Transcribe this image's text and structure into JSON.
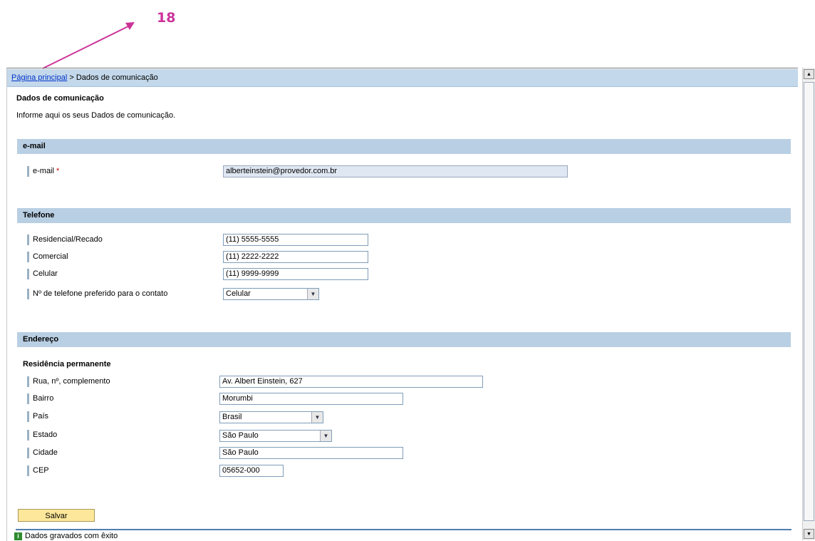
{
  "annotation": {
    "number": "18",
    "color": "#cc3399"
  },
  "breadcrumb": {
    "home_link": "Página principal",
    "separator": ">",
    "current": "Dados de comunicação"
  },
  "page": {
    "title": "Dados de comunicação",
    "description": "Informe aqui os seus Dados de comunicação."
  },
  "email_section": {
    "title": "e-mail",
    "label": "e-mail",
    "required_mark": "*",
    "value": "alberteinstein@provedor.com.br"
  },
  "phone_section": {
    "title": "Telefone",
    "residential": {
      "label": "Residencial/Recado",
      "value": "(11) 5555-5555"
    },
    "commercial": {
      "label": "Comercial",
      "value": "(11) 2222-2222"
    },
    "mobile": {
      "label": "Celular",
      "value": "(11) 9999-9999"
    },
    "preferred": {
      "label": "Nº de telefone preferido para o contato",
      "value": "Celular"
    }
  },
  "address_section": {
    "title": "Endereço",
    "subtitle": "Residência permanente",
    "street": {
      "label": "Rua, nº, complemento",
      "value": "Av. Albert Einstein, 627"
    },
    "district": {
      "label": "Bairro",
      "value": "Morumbi"
    },
    "country": {
      "label": "País",
      "value": "Brasil"
    },
    "state": {
      "label": "Estado",
      "value": "São Paulo"
    },
    "city": {
      "label": "Cidade",
      "value": "São Paulo"
    },
    "zip": {
      "label": "CEP",
      "value": "05652-000"
    }
  },
  "actions": {
    "save_label": "Salvar"
  },
  "status": {
    "message": "Dados gravados com êxito",
    "icon": "info-icon"
  },
  "colors": {
    "section_header": "#b9cfe3",
    "breadcrumb_bar": "#c3d8ea",
    "save_button": "#fde79a",
    "link": "#0033cc"
  }
}
